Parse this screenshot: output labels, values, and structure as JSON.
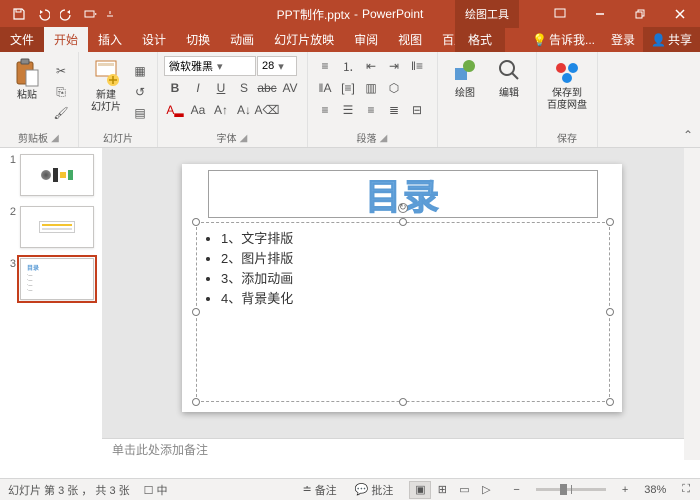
{
  "title": {
    "filename": "PPT制作.pptx",
    "app": "PowerPoint",
    "contextual": "绘图工具"
  },
  "tabs": {
    "file": "文件",
    "home": "开始",
    "insert": "插入",
    "design": "设计",
    "transition": "切换",
    "animation": "动画",
    "slideshow": "幻灯片放映",
    "review": "审阅",
    "view": "视图",
    "baidu": "百度网盘",
    "format": "格式",
    "tell": "告诉我...",
    "login": "登录",
    "share": "共享"
  },
  "ribbon": {
    "clipboard": {
      "label": "剪贴板",
      "paste": "粘贴"
    },
    "slides": {
      "label": "幻灯片",
      "new": "新建\n幻灯片"
    },
    "font": {
      "label": "字体",
      "name": "微软雅黑",
      "size": "28"
    },
    "paragraph": {
      "label": "段落"
    },
    "drawing": {
      "label": "绘图",
      "draw": "绘图",
      "edit": "编辑"
    },
    "save": {
      "label": "保存",
      "saveto": "保存到\n百度网盘"
    }
  },
  "slide": {
    "title": "目录",
    "items": [
      "1、文字排版",
      "2、图片排版",
      "3、添加动画",
      "4、背景美化"
    ],
    "notes_placeholder": "单击此处添加备注"
  },
  "thumbs": [
    1,
    2,
    3
  ],
  "status": {
    "slideinfo": "幻灯片 第 3 张 ， 共 3 张",
    "lang": "",
    "notes": "备注",
    "comments": "批注",
    "zoom": "38%"
  }
}
